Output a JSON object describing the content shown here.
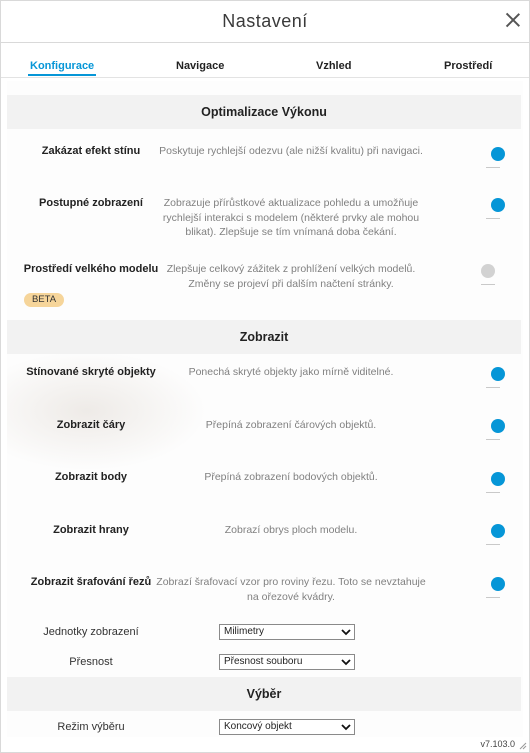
{
  "dialog": {
    "title": "Nastavení",
    "version": "v7.103.0"
  },
  "tabs": [
    {
      "label": "Konfigurace"
    },
    {
      "label": "Navigace"
    },
    {
      "label": "Vzhled"
    },
    {
      "label": "Prostředí"
    }
  ],
  "sections": {
    "performance": {
      "title": "Optimalizace Výkonu",
      "items": [
        {
          "label": "Zakázat efekt stínu",
          "desc": "Poskytuje rychlejší odezvu (ale nižší kvalitu) při navigaci.",
          "on": true
        },
        {
          "label": "Postupné zobrazení",
          "desc": "Zobrazuje přírůstkové aktualizace pohledu a umožňuje rychlejší interakci s modelem (některé prvky ale mohou blikat). Zlepšuje se tím vnímaná doba čekání.",
          "on": true
        },
        {
          "label": "Prostředí velkého modelu",
          "desc": "Zlepšuje celkový zážitek z prohlížení velkých modelů. Změny se projeví při dalším načtení stránky.",
          "on": false,
          "badge": "BETA"
        }
      ]
    },
    "display": {
      "title": "Zobrazit",
      "items": [
        {
          "label": "Stínované skryté objekty",
          "desc": "Ponechá skryté objekty jako mírně viditelné.",
          "on": true
        },
        {
          "label": "Zobrazit čáry",
          "desc": "Přepíná zobrazení čárových objektů.",
          "on": true
        },
        {
          "label": "Zobrazit body",
          "desc": "Přepíná zobrazení bodových objektů.",
          "on": true
        },
        {
          "label": "Zobrazit hrany",
          "desc": "Zobrazí obrys ploch modelu.",
          "on": true
        },
        {
          "label": "Zobrazit šrafování řezů",
          "desc": "Zobrazí šrafovací vzor pro roviny řezu. Toto se nevztahuje na ořezové kvádry.",
          "on": true
        }
      ],
      "units": {
        "label": "Jednotky zobrazení",
        "value": "Milimetry"
      },
      "precision": {
        "label": "Přesnost",
        "value": "Přesnost souboru"
      }
    },
    "selection": {
      "title": "Výběr",
      "mode": {
        "label": "Režim výběru",
        "value": "Koncový objekt"
      }
    }
  },
  "colors": {
    "accent": "#0696d7",
    "toggle_off": "#d2d2d2",
    "beta": "#f6d59a"
  }
}
